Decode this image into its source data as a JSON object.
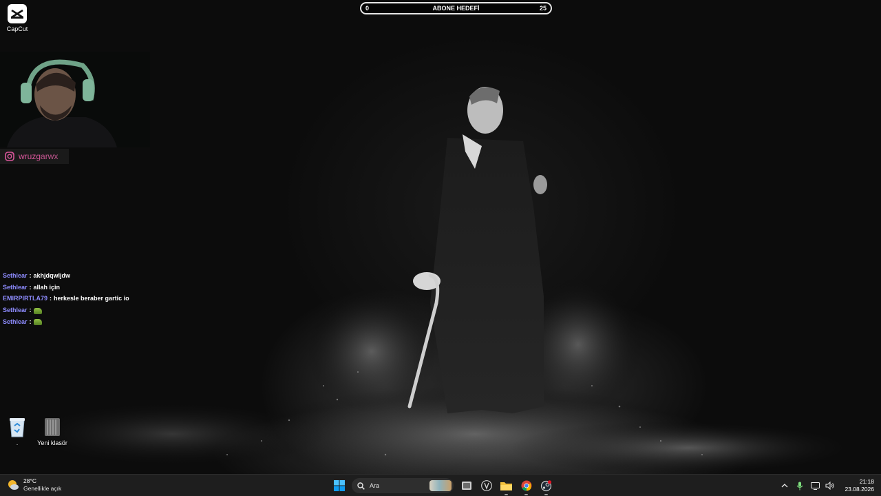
{
  "desktop": {
    "icons": [
      {
        "name": "capcut",
        "label": "CapCut"
      },
      {
        "name": "recycle-bin",
        "label": "."
      },
      {
        "name": "new-folder",
        "label": "Yeni klasör"
      }
    ]
  },
  "overlay": {
    "goal": {
      "title": "ABONE HEDEFİ",
      "current": "0",
      "target": "25",
      "progress": 0
    },
    "social": {
      "platform_icon": "instagram-icon",
      "handle_part1": "wruzg",
      "handle_part2": "arwx"
    },
    "chat": [
      {
        "user": "Sethlear",
        "sep": ":",
        "text": "akhjdqwljdw",
        "emote": false
      },
      {
        "user": "Sethlear",
        "sep": ":",
        "text": "allah için",
        "emote": false
      },
      {
        "user": "EMIRPIRTLA79",
        "sep": ":",
        "text": "herkesle beraber gartic io",
        "emote": false
      },
      {
        "user": "Sethlear",
        "sep": ":",
        "text": "",
        "emote": true
      },
      {
        "user": "Sethlear",
        "sep": ":",
        "text": "",
        "emote": true
      }
    ]
  },
  "taskbar": {
    "weather": {
      "temp": "28°C",
      "condition": "Genellikle açık",
      "icon": "partly-cloudy-icon"
    },
    "search": {
      "placeholder": "Ara"
    },
    "apps": [
      "start-icon",
      "task-view-icon",
      "app-icon",
      "file-explorer-icon",
      "chrome-icon",
      "steam-icon"
    ],
    "tray": {
      "icons": [
        "chevron-up-icon",
        "microphone-icon",
        "network-icon",
        "volume-icon"
      ],
      "time": "21:18",
      "date": "23.08.2026"
    },
    "colors": {
      "background": "#1e1e1e",
      "accent": "#0078d4"
    }
  }
}
